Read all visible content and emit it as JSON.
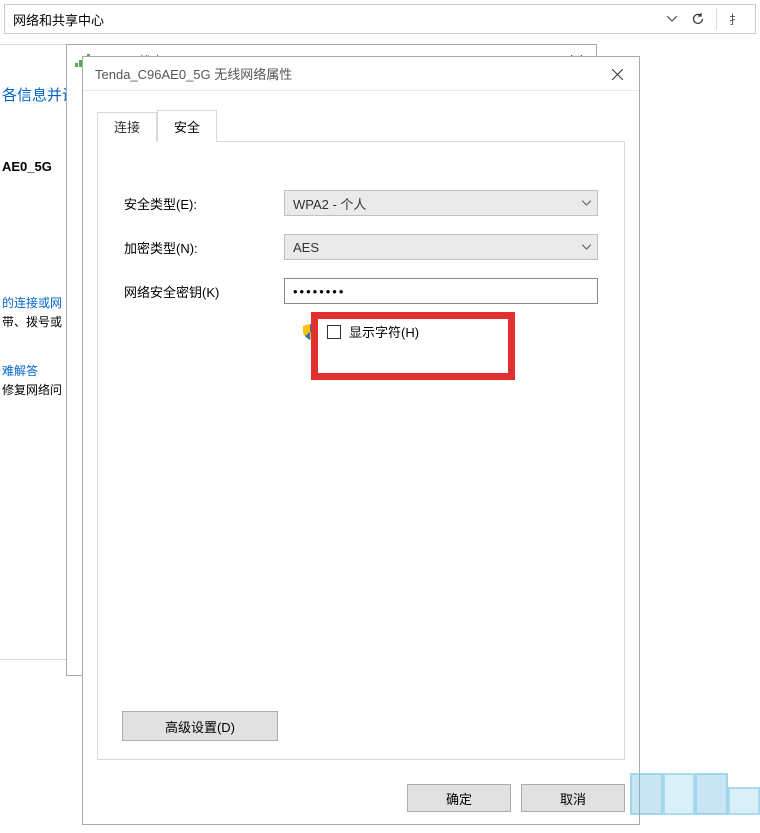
{
  "addressBar": {
    "text": "网络和共享中心"
  },
  "bg": {
    "headerLink": "各信息并设",
    "networkName": "AE0_5G",
    "link1": "的连接或网",
    "line2": "带、拨号或",
    "link3": "难解答",
    "line4": "修复网络问"
  },
  "window2": {
    "title": "WLAN 状态"
  },
  "dialog": {
    "title": "Tenda_C96AE0_5G 无线网络属性",
    "tabs": {
      "connection": "连接",
      "security": "安全"
    },
    "form": {
      "securityTypeLabel": "安全类型(E):",
      "securityTypeValue": "WPA2 - 个人",
      "encryptionTypeLabel": "加密类型(N):",
      "encryptionTypeValue": "AES",
      "keyLabel": "网络安全密钥(K)",
      "keyValue": "••••••••",
      "showCharsLabel": "显示字符(H)"
    },
    "advancedButton": "高级设置(D)",
    "okButton": "确定",
    "cancelButton": "取消"
  }
}
